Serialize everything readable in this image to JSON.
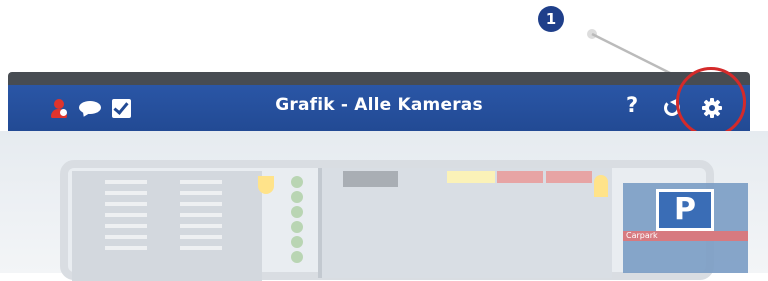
{
  "callout": {
    "number": "1"
  },
  "toolbar": {
    "title": "Grafik - Alle Kameras",
    "help_label": "?",
    "left_icons": [
      "user-alert-icon",
      "chat-icon",
      "checkbox-icon"
    ],
    "right_icons": [
      "help-icon",
      "refresh-icon",
      "gear-icon"
    ]
  },
  "colors": {
    "toolbar": "#224a94",
    "top_strip": "#474c52",
    "highlight": "#d42a2a",
    "callout_badge": "#1f3f8a"
  },
  "plan": {
    "parking_sign": "P",
    "parking_label": "Carpark"
  }
}
